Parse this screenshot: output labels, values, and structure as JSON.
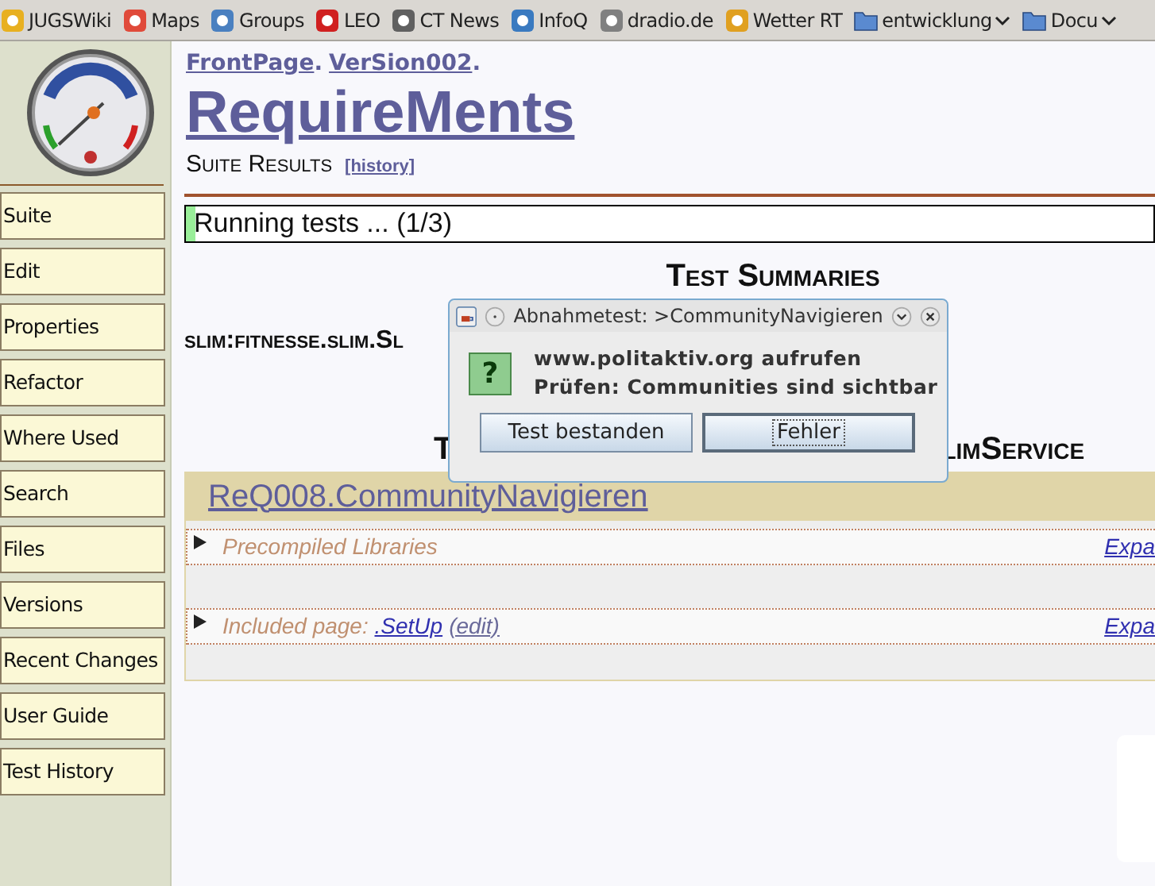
{
  "bookmarks": [
    {
      "label": "JUGSWiki",
      "kind": "site",
      "color": "#e8b020"
    },
    {
      "label": "Maps",
      "kind": "site",
      "color": "#e04a3a"
    },
    {
      "label": "Groups",
      "kind": "site",
      "color": "#4a80c0"
    },
    {
      "label": "LEO",
      "kind": "site",
      "color": "#d02020"
    },
    {
      "label": "CT News",
      "kind": "site",
      "color": "#606060"
    },
    {
      "label": "InfoQ",
      "kind": "site",
      "color": "#3a7ac0"
    },
    {
      "label": "dradio.de",
      "kind": "site",
      "color": "#808080"
    },
    {
      "label": "Wetter RT",
      "kind": "site",
      "color": "#e0a020"
    },
    {
      "label": "entwicklung",
      "kind": "folder",
      "color": "#5a8ad0"
    },
    {
      "label": "Docu",
      "kind": "folder",
      "color": "#5a8ad0"
    }
  ],
  "sidebar": {
    "items": [
      "Suite",
      "Edit",
      "Properties",
      "Refactor",
      "Where Used",
      "Search",
      "Files",
      "Versions",
      "Recent Changes",
      "User Guide",
      "Test History"
    ]
  },
  "breadcrumb": [
    {
      "label": "FrontPage",
      "separator": "."
    },
    {
      "label": "VerSion002",
      "separator": "."
    }
  ],
  "page_title": "RequireMents",
  "subtitle": "Suite Results",
  "history_link": "[history]",
  "progress": {
    "text": "Running tests ... (1/3)",
    "level": 0.01
  },
  "summaries_heading": "Test Summaries",
  "suite_heading": "slim:fitnesse.slim.Sl",
  "results_heading": {
    "left": "T",
    "right": "limService"
  },
  "test_page": {
    "title": "ReQ008.CommunityNavigieren",
    "sections": [
      {
        "kind": "plain",
        "label": "Precompiled Libraries",
        "expand": "Expa",
        "expanded": false
      },
      {
        "kind": "include",
        "label": "Included page: ",
        "link": ".SetUp",
        "edit": "(edit)",
        "expand": "Expa",
        "expanded": false
      }
    ]
  },
  "dialog": {
    "title": "Abnahmetest: >CommunityNavigieren",
    "icon_glyph": "?",
    "lines": [
      "www.politaktiv.org aufrufen",
      "Prüfen: Communities sind sichtbar"
    ],
    "buttons": [
      {
        "label": "Test bestanden",
        "focused": false
      },
      {
        "label": "Fehler",
        "focused": true
      }
    ]
  }
}
